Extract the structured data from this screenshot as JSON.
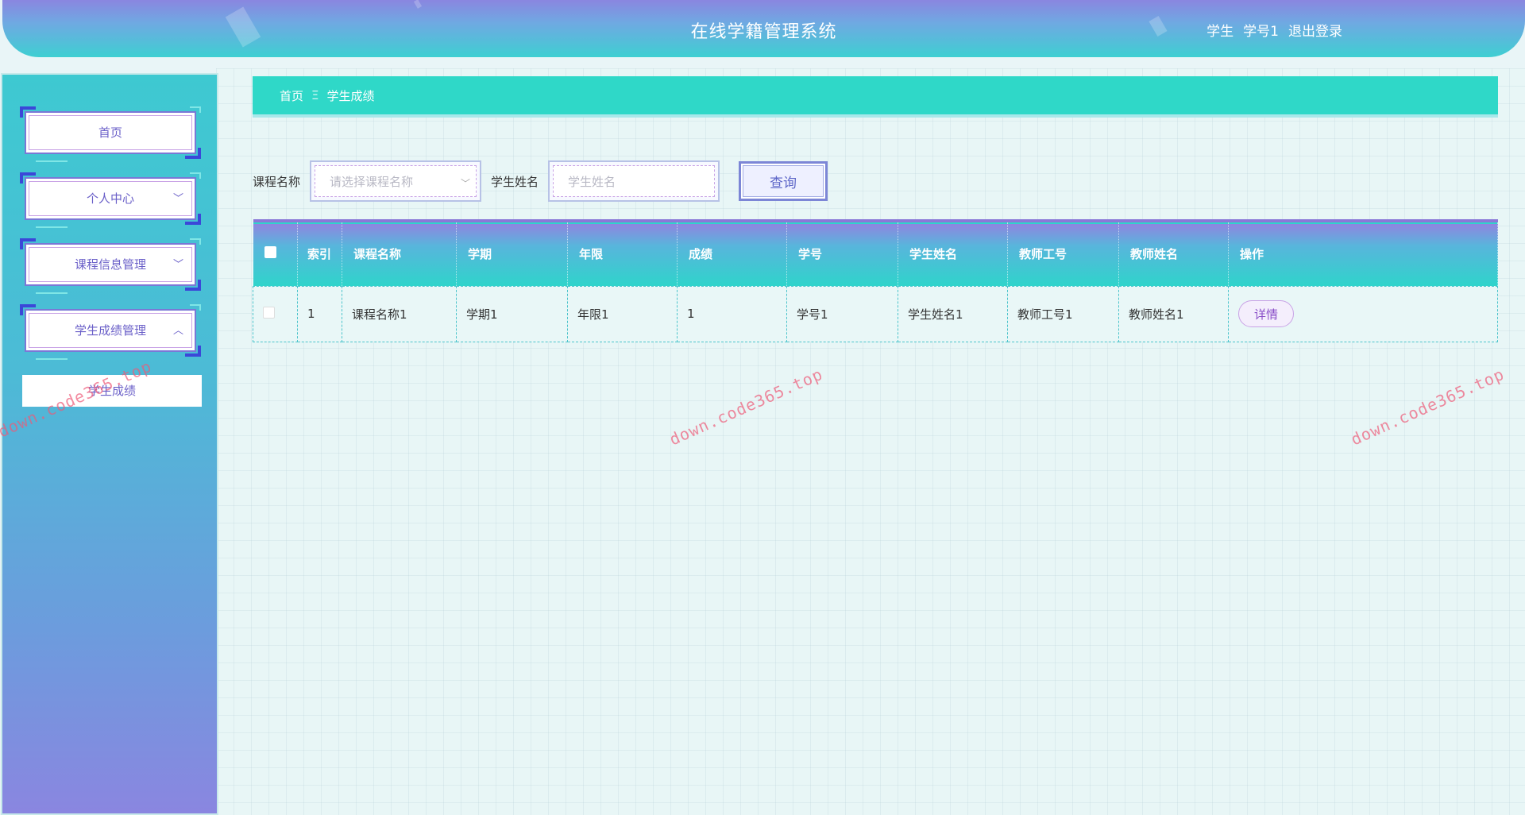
{
  "header": {
    "title": "在线学籍管理系统",
    "user_role": "学生",
    "user_name": "学号1",
    "logout_label": "退出登录"
  },
  "sidebar": {
    "items": [
      {
        "label": "首页",
        "chevron": ""
      },
      {
        "label": "个人中心",
        "chevron": "﹀"
      },
      {
        "label": "课程信息管理",
        "chevron": "﹀"
      },
      {
        "label": "学生成绩管理",
        "chevron": "︿"
      }
    ],
    "sub_item": "学生成绩"
  },
  "breadcrumb": {
    "home": "首页",
    "separator": "Ξ",
    "current": "学生成绩"
  },
  "search": {
    "course_label": "课程名称",
    "course_placeholder": "请选择课程名称",
    "student_label": "学生姓名",
    "student_placeholder": "学生姓名",
    "query_label": "查询"
  },
  "table": {
    "headers": [
      "",
      "索引",
      "课程名称",
      "学期",
      "年限",
      "成绩",
      "学号",
      "学生姓名",
      "教师工号",
      "教师姓名",
      "操作"
    ],
    "rows": [
      {
        "index": "1",
        "course": "课程名称1",
        "term": "学期1",
        "year": "年限1",
        "score": "1",
        "student_no": "学号1",
        "student_name": "学生姓名1",
        "teacher_no": "教师工号1",
        "teacher_name": "教师姓名1",
        "action": "详情"
      }
    ]
  },
  "watermark": "down.code365.top",
  "colors": {
    "accent_teal": "#2fd8c8",
    "accent_purple": "#8a86e0",
    "menu_text": "#6a5fc8"
  }
}
